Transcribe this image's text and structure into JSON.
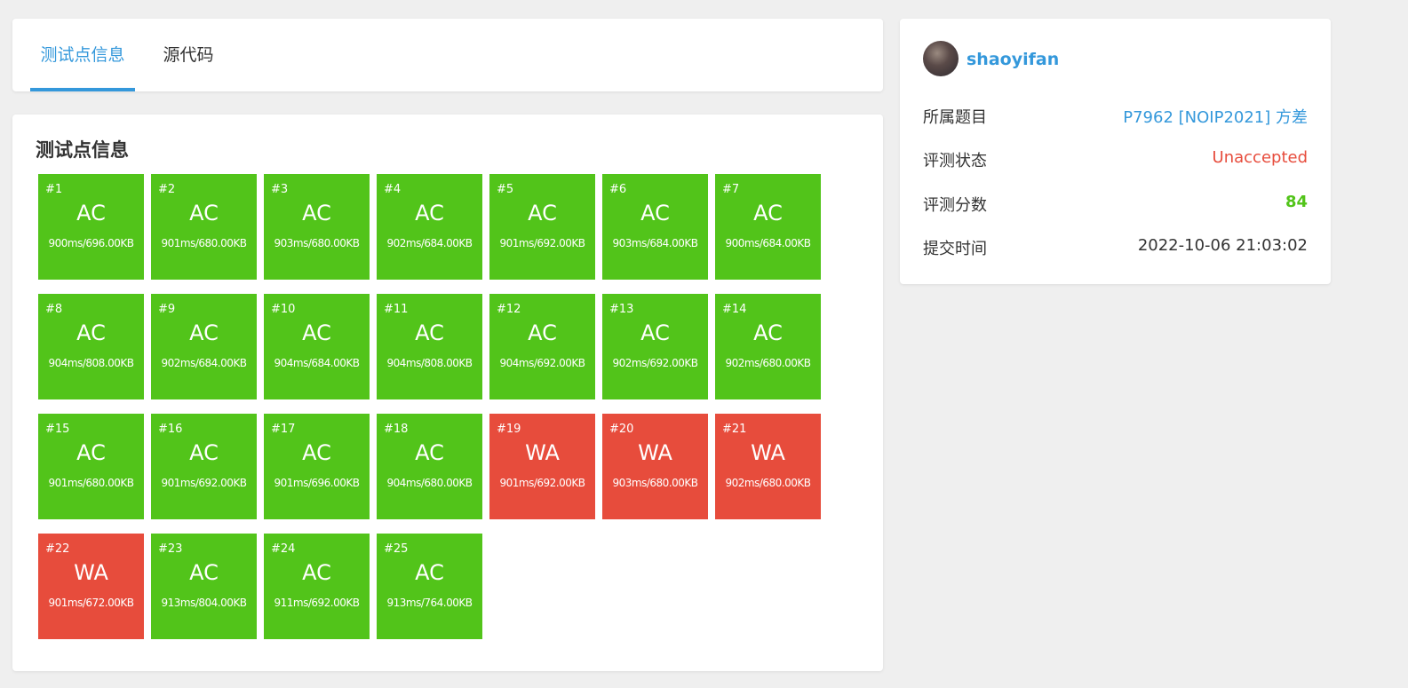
{
  "tabs": [
    {
      "label": "测试点信息",
      "active": true
    },
    {
      "label": "源代码",
      "active": false
    }
  ],
  "cases_section": {
    "title": "测试点信息",
    "cases": [
      {
        "id": "#1",
        "status": "AC",
        "info": "900ms/696.00KB"
      },
      {
        "id": "#2",
        "status": "AC",
        "info": "901ms/680.00KB"
      },
      {
        "id": "#3",
        "status": "AC",
        "info": "903ms/680.00KB"
      },
      {
        "id": "#4",
        "status": "AC",
        "info": "902ms/684.00KB"
      },
      {
        "id": "#5",
        "status": "AC",
        "info": "901ms/692.00KB"
      },
      {
        "id": "#6",
        "status": "AC",
        "info": "903ms/684.00KB"
      },
      {
        "id": "#7",
        "status": "AC",
        "info": "900ms/684.00KB"
      },
      {
        "id": "#8",
        "status": "AC",
        "info": "904ms/808.00KB"
      },
      {
        "id": "#9",
        "status": "AC",
        "info": "902ms/684.00KB"
      },
      {
        "id": "#10",
        "status": "AC",
        "info": "904ms/684.00KB"
      },
      {
        "id": "#11",
        "status": "AC",
        "info": "904ms/808.00KB"
      },
      {
        "id": "#12",
        "status": "AC",
        "info": "904ms/692.00KB"
      },
      {
        "id": "#13",
        "status": "AC",
        "info": "902ms/692.00KB"
      },
      {
        "id": "#14",
        "status": "AC",
        "info": "902ms/680.00KB"
      },
      {
        "id": "#15",
        "status": "AC",
        "info": "901ms/680.00KB"
      },
      {
        "id": "#16",
        "status": "AC",
        "info": "901ms/692.00KB"
      },
      {
        "id": "#17",
        "status": "AC",
        "info": "901ms/696.00KB"
      },
      {
        "id": "#18",
        "status": "AC",
        "info": "904ms/680.00KB"
      },
      {
        "id": "#19",
        "status": "WA",
        "info": "901ms/692.00KB"
      },
      {
        "id": "#20",
        "status": "WA",
        "info": "903ms/680.00KB"
      },
      {
        "id": "#21",
        "status": "WA",
        "info": "902ms/680.00KB"
      },
      {
        "id": "#22",
        "status": "WA",
        "info": "901ms/672.00KB"
      },
      {
        "id": "#23",
        "status": "AC",
        "info": "913ms/804.00KB"
      },
      {
        "id": "#24",
        "status": "AC",
        "info": "911ms/692.00KB"
      },
      {
        "id": "#25",
        "status": "AC",
        "info": "913ms/764.00KB"
      }
    ]
  },
  "submission": {
    "avatar_icon": "user-avatar",
    "username": "shaoyifan",
    "problem_label": "所属题目",
    "problem_value": "P7962 [NOIP2021] 方差",
    "status_label": "评测状态",
    "status_value": "Unaccepted",
    "score_label": "评测分数",
    "score_value": "84",
    "time_label": "提交时间",
    "time_value": "2022-10-06 21:03:02"
  },
  "colors": {
    "accent": "#3498db",
    "ac": "#52c41a",
    "wa": "#e74c3c",
    "background": "#efefef"
  }
}
